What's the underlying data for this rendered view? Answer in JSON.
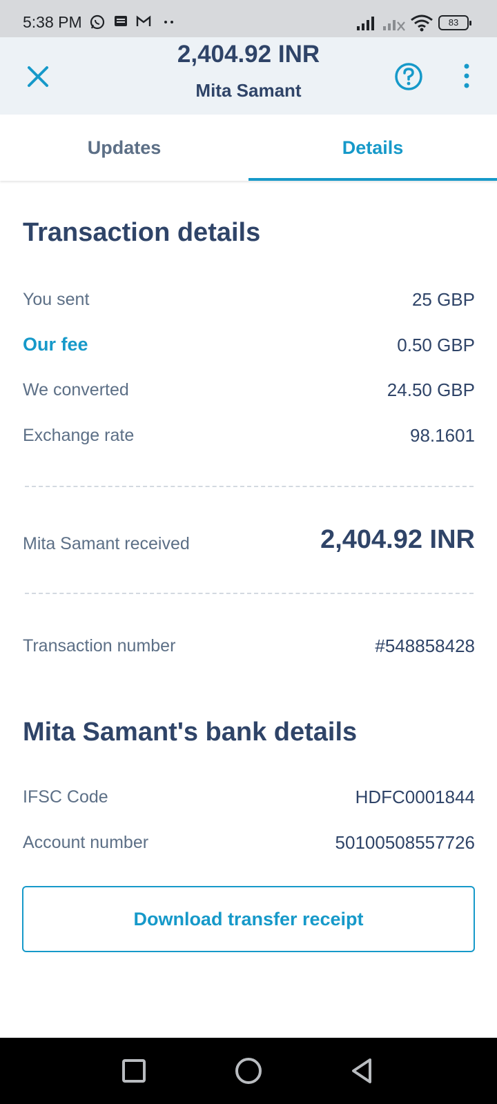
{
  "status_bar": {
    "time": "5:38 PM",
    "battery": "83"
  },
  "header": {
    "amount": "2,404.92 INR",
    "recipient": "Mita Samant"
  },
  "tabs": [
    {
      "label": "Updates",
      "active": false
    },
    {
      "label": "Details",
      "active": true
    }
  ],
  "transaction": {
    "title": "Transaction details",
    "rows": [
      {
        "label": "You sent",
        "value": "25 GBP"
      },
      {
        "label": "Our fee",
        "value": "0.50 GBP"
      },
      {
        "label": "We converted",
        "value": "24.50 GBP"
      },
      {
        "label": "Exchange rate",
        "value": "98.1601"
      }
    ],
    "received_label": "Mita Samant received",
    "received_value": "2,404.92 INR",
    "number_label": "Transaction number",
    "number_value": "#548858428"
  },
  "bank": {
    "title": "Mita Samant's bank details",
    "rows": [
      {
        "label": "IFSC Code",
        "value": "HDFC0001844"
      },
      {
        "label": "Account number",
        "value": "50100508557726"
      }
    ]
  },
  "actions": {
    "download_label": "Download transfer receipt"
  },
  "colors": {
    "accent": "#1699c9",
    "text_primary": "#2f4468",
    "text_secondary": "#5c6f86",
    "header_bg": "#edf2f6"
  },
  "icons": [
    "whatsapp-icon",
    "message-icon",
    "gmail-icon",
    "signal-icon",
    "wifi-icon",
    "battery-icon",
    "close-icon",
    "help-icon",
    "more-vert-icon",
    "recents-icon",
    "home-icon",
    "back-icon"
  ]
}
